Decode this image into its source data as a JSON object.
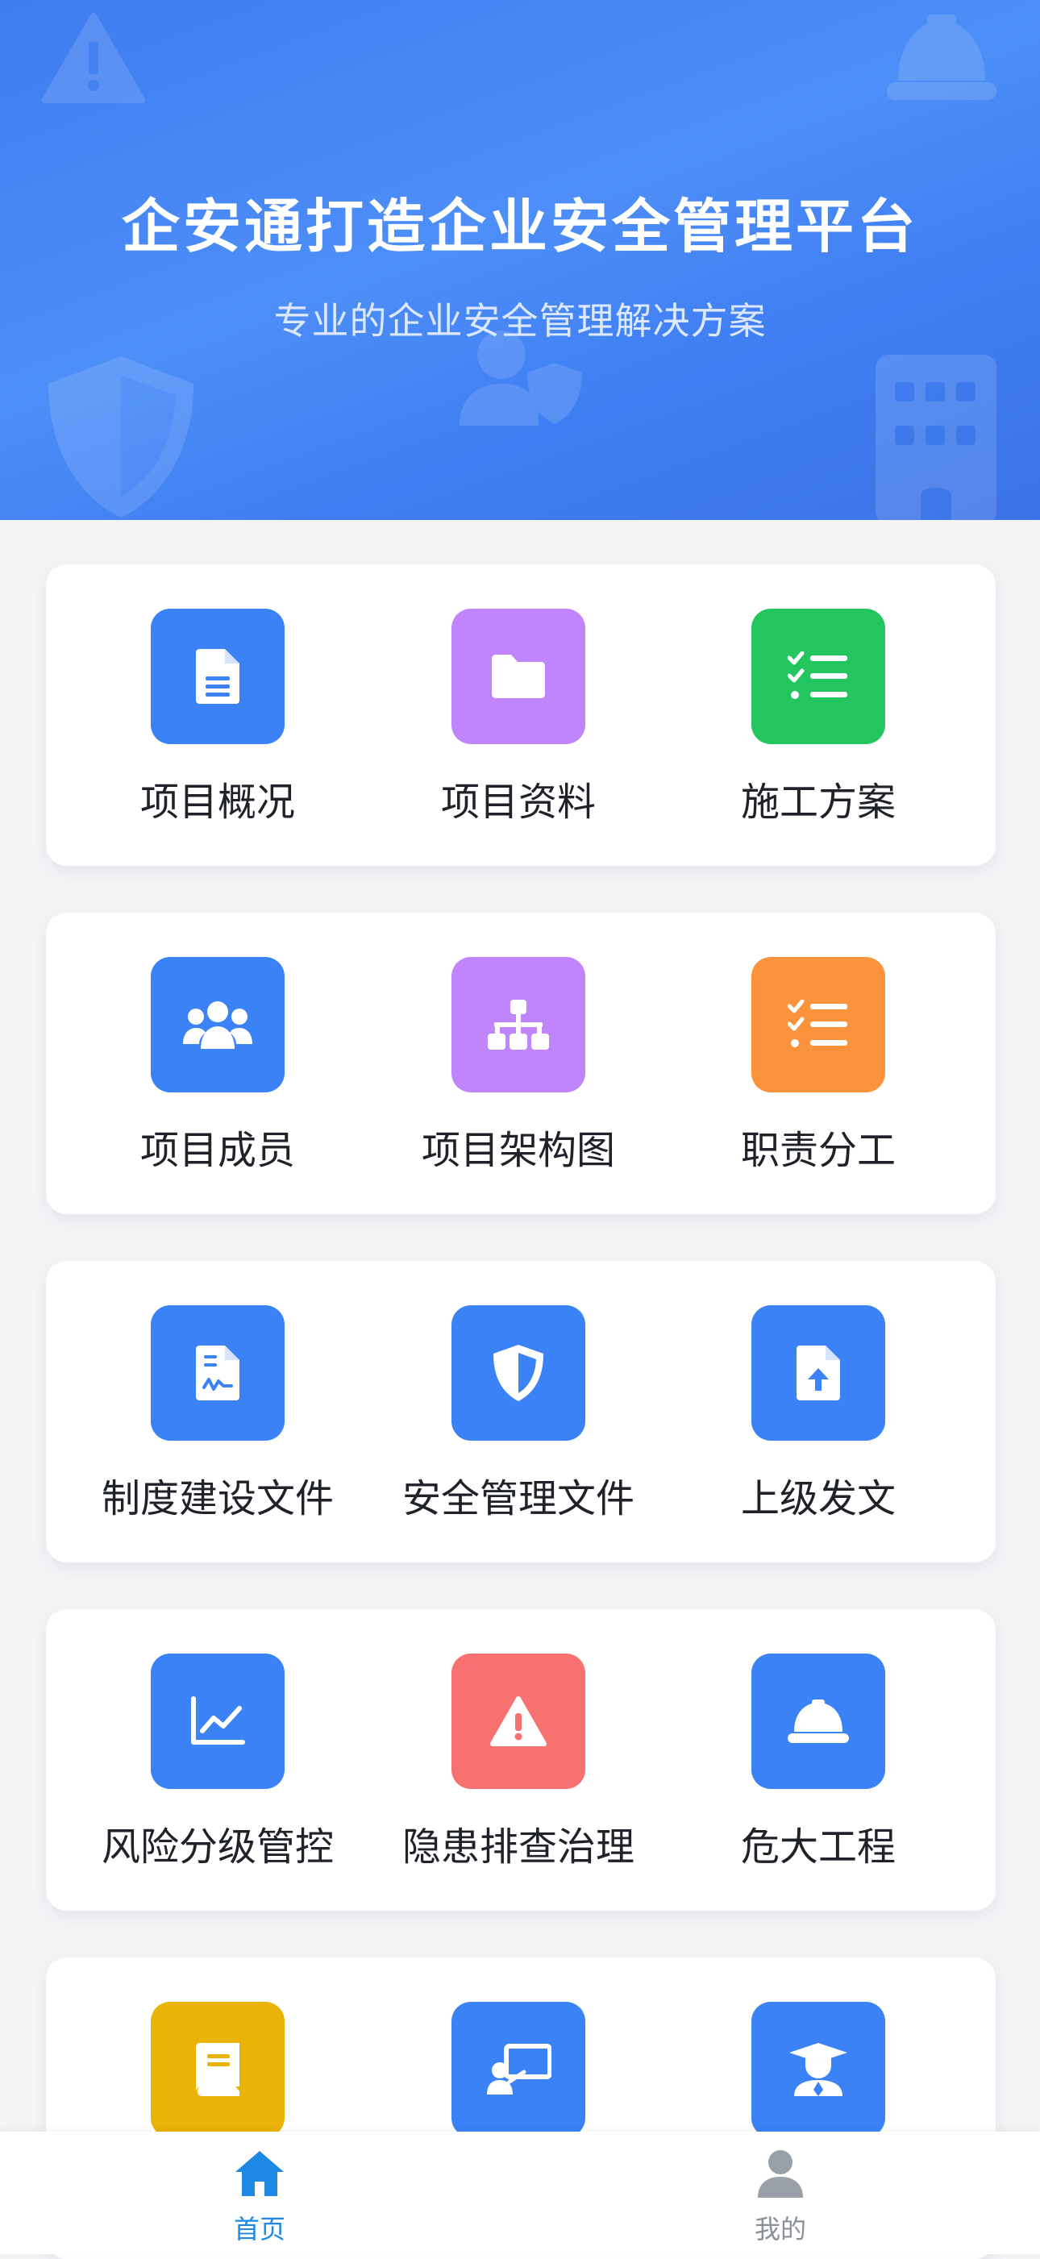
{
  "hero": {
    "title": "企安通打造企业安全管理平台",
    "subtitle": "专业的企业安全管理解决方案"
  },
  "grid": [
    [
      {
        "label": "项目概况",
        "icon": "document-icon",
        "color": "#3b82f6"
      },
      {
        "label": "项目资料",
        "icon": "folder-icon",
        "color": "#c084fc"
      },
      {
        "label": "施工方案",
        "icon": "checklist-icon",
        "color": "#22c55e"
      }
    ],
    [
      {
        "label": "项目成员",
        "icon": "users-icon",
        "color": "#3b82f6"
      },
      {
        "label": "项目架构图",
        "icon": "org-chart-icon",
        "color": "#c084fc"
      },
      {
        "label": "职责分工",
        "icon": "checklist-icon",
        "color": "#fb923c"
      }
    ],
    [
      {
        "label": "制度建设文件",
        "icon": "signed-document-icon",
        "color": "#3b82f6"
      },
      {
        "label": "安全管理文件",
        "icon": "shield-icon",
        "color": "#3b82f6"
      },
      {
        "label": "上级发文",
        "icon": "file-upload-icon",
        "color": "#3b82f6"
      }
    ],
    [
      {
        "label": "风险分级管控",
        "icon": "line-chart-icon",
        "color": "#3b82f6"
      },
      {
        "label": "隐患排查治理",
        "icon": "warning-icon",
        "color": "#f87171"
      },
      {
        "label": "危大工程",
        "icon": "hard-hat-icon",
        "color": "#3b82f6"
      }
    ],
    [
      {
        "label": "",
        "icon": "book-icon",
        "color": "#eab308"
      },
      {
        "label": "",
        "icon": "presentation-icon",
        "color": "#3b82f6"
      },
      {
        "label": "",
        "icon": "graduate-icon",
        "color": "#3b82f6"
      }
    ]
  ],
  "tabbar": {
    "home_label": "首页",
    "mine_label": "我的",
    "active_color": "#1e88e5",
    "inactive_color": "#8a8f99"
  }
}
